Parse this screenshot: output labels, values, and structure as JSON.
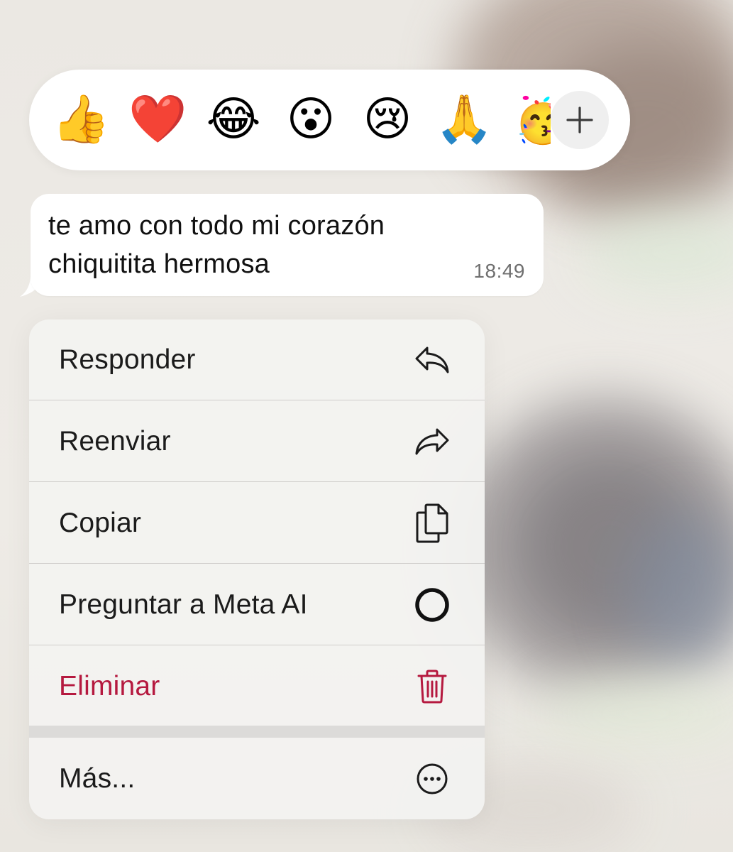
{
  "reactions": {
    "emojis": [
      {
        "char": "👍",
        "name": "thumbs-up"
      },
      {
        "char": "❤️",
        "name": "red-heart"
      },
      {
        "char": "😂",
        "name": "tears-of-joy"
      },
      {
        "char": "😮",
        "name": "open-mouth"
      },
      {
        "char": "😢",
        "name": "crying-face"
      },
      {
        "char": "🙏",
        "name": "folded-hands"
      },
      {
        "char": "🥳",
        "name": "partying-face"
      }
    ],
    "more_icon": "plus-icon"
  },
  "message": {
    "line1": "te amo con todo mi corazón",
    "line2": "chiquitita hermosa",
    "time": "18:49"
  },
  "menu": {
    "items": [
      {
        "label": "Responder",
        "icon": "reply-icon"
      },
      {
        "label": "Reenviar",
        "icon": "forward-icon"
      },
      {
        "label": "Copiar",
        "icon": "copy-icon"
      },
      {
        "label": "Preguntar a Meta AI",
        "icon": "meta-ai-icon"
      },
      {
        "label": "Eliminar",
        "icon": "trash-icon"
      },
      {
        "label": "Más...",
        "icon": "more-icon"
      }
    ]
  },
  "colors": {
    "danger": "#b5193f",
    "text": "#1b1b1b",
    "timestamp": "#6f6f6f"
  }
}
